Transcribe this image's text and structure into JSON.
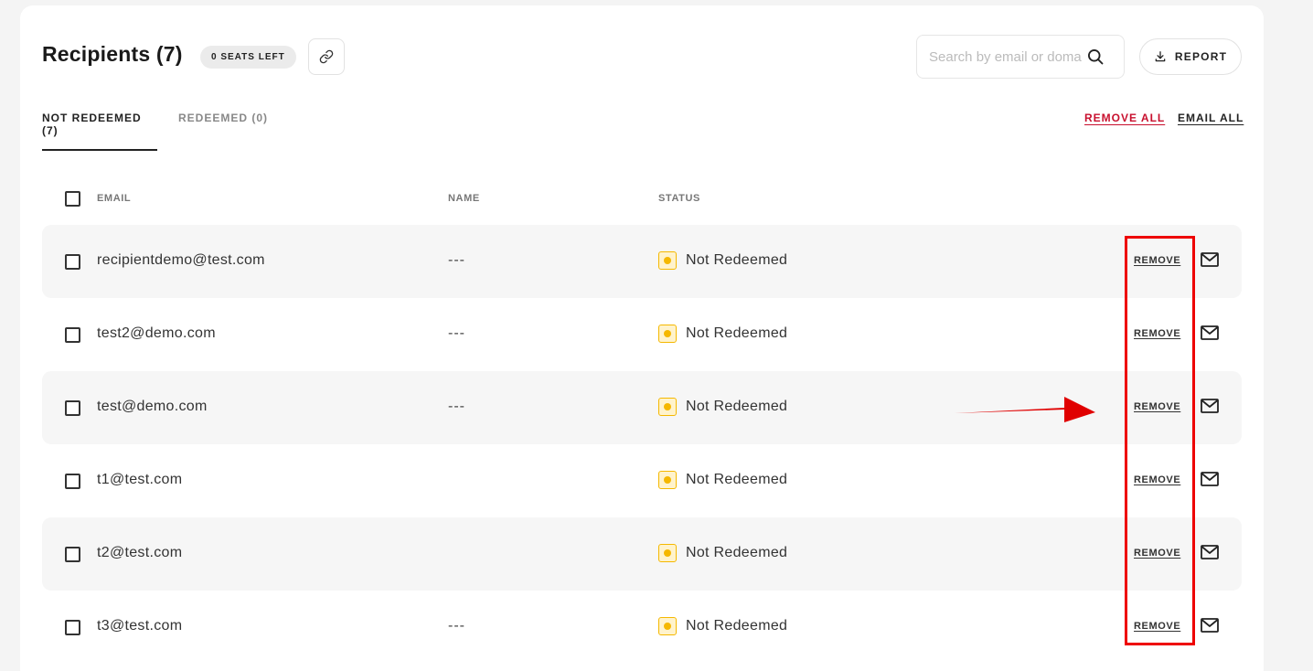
{
  "header": {
    "title": "Recipients (7)",
    "seats_badge": "0 SEATS LEFT",
    "search_placeholder": "Search by email or doma",
    "report_label": "REPORT"
  },
  "tabs": {
    "not_redeemed": "NOT REDEEMED (7)",
    "redeemed": "REDEEMED (0)"
  },
  "actions": {
    "remove_all": "REMOVE ALL",
    "email_all": "EMAIL ALL"
  },
  "table": {
    "columns": {
      "email": "EMAIL",
      "name": "NAME",
      "status": "STATUS"
    },
    "remove_label": "REMOVE",
    "rows": [
      {
        "email": "recipientdemo@test.com",
        "name": "---",
        "status": "Not Redeemed"
      },
      {
        "email": "test2@demo.com",
        "name": "---",
        "status": "Not Redeemed"
      },
      {
        "email": "test@demo.com",
        "name": "---",
        "status": "Not Redeemed"
      },
      {
        "email": "t1@test.com",
        "name": "",
        "status": "Not Redeemed"
      },
      {
        "email": "t2@test.com",
        "name": "",
        "status": "Not Redeemed"
      },
      {
        "email": "t3@test.com",
        "name": "---",
        "status": "Not Redeemed"
      }
    ]
  },
  "colors": {
    "danger": "#c8102e",
    "status_pending": "#f5b800",
    "annotation": "#e00000"
  }
}
